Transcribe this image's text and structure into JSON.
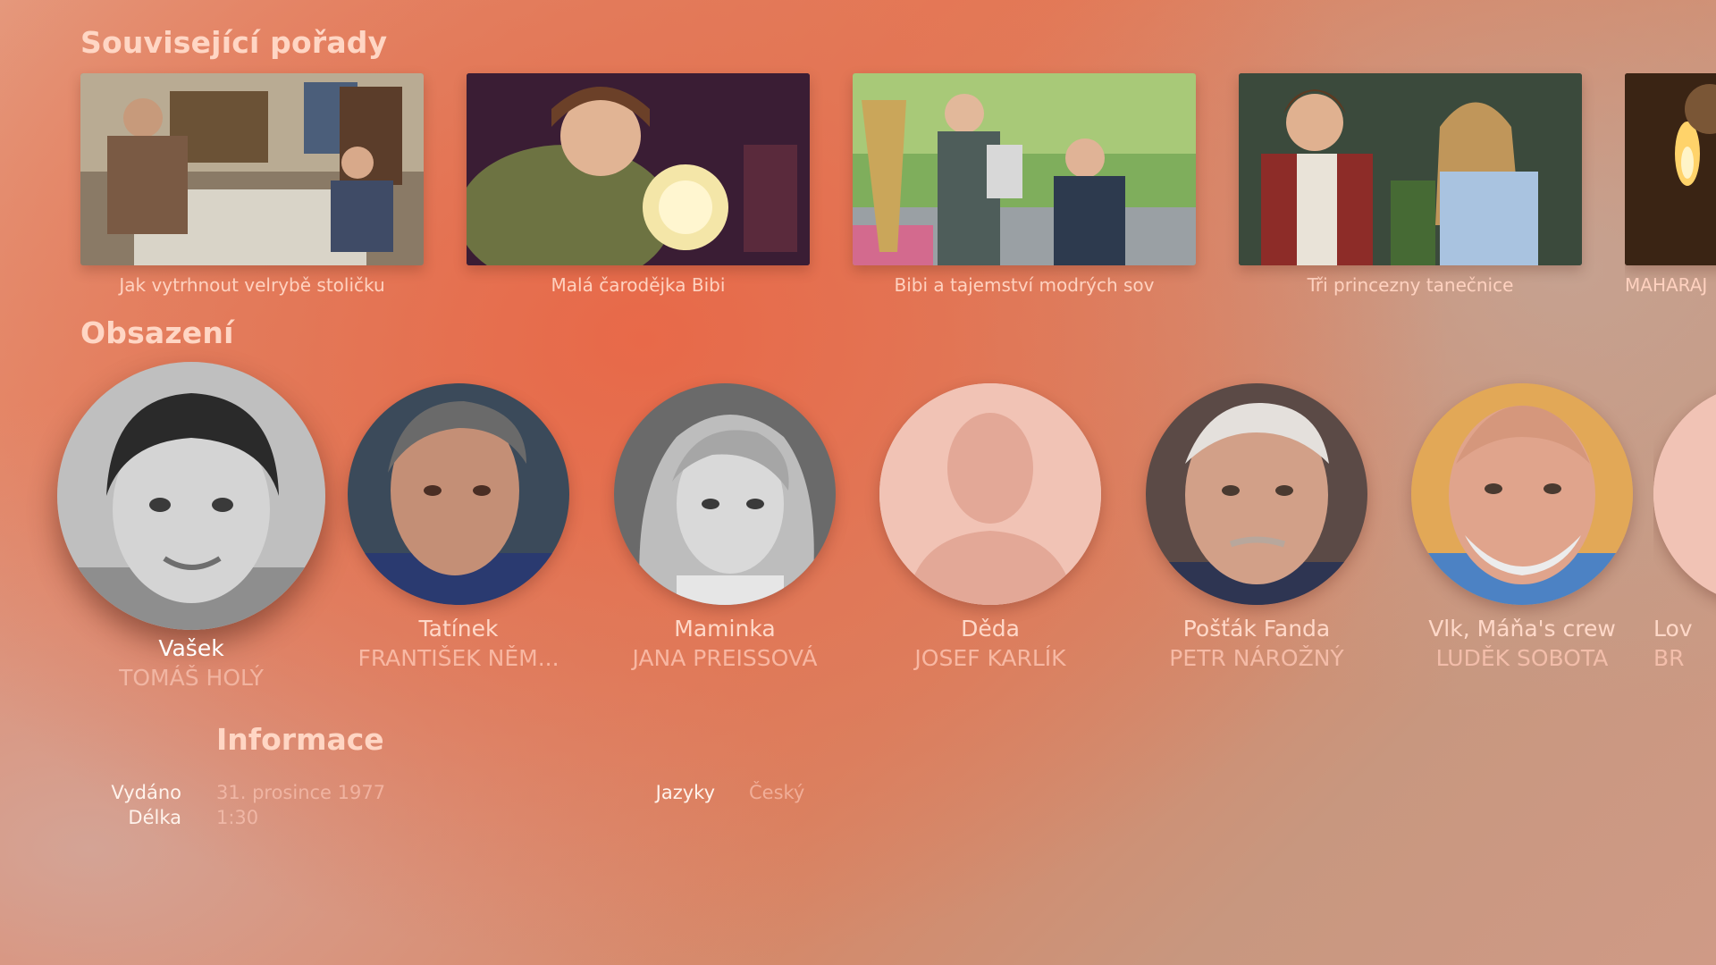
{
  "sections": {
    "related_title": "Související pořady",
    "cast_title": "Obsazení",
    "info_title": "Informace"
  },
  "related": [
    {
      "title": "Jak vytrhnout velrybě stoličku"
    },
    {
      "title": "Malá čarodějka Bibi"
    },
    {
      "title": "Bibi a tajemství modrých sov"
    },
    {
      "title": "Tři princezny tanečnice"
    },
    {
      "title": "MAHARAJ"
    }
  ],
  "cast": [
    {
      "role": "Vašek",
      "actor": "TOMÁŠ HOLÝ",
      "focused": true
    },
    {
      "role": "Tatínek",
      "actor": "FRANTIŠEK NĚM..."
    },
    {
      "role": "Maminka",
      "actor": "JANA PREISSOVÁ"
    },
    {
      "role": "Děda",
      "actor": "JOSEF KARLÍK"
    },
    {
      "role": "Pošťák Fanda",
      "actor": "PETR NÁROŽNÝ"
    },
    {
      "role": "Vlk, Máňa's crew",
      "actor": "LUDĚK SOBOTA"
    },
    {
      "role": "Lov",
      "actor": "BR"
    }
  ],
  "info": {
    "released_label": "Vydáno",
    "released_value": "31. prosince 1977",
    "length_label": "Délka",
    "length_value": "1:30",
    "languages_label": "Jazyky",
    "languages_value": "Český"
  },
  "colors": {
    "accent_text": "#ffd6c4",
    "background_core": "#e57a57",
    "placeholder_avatar": "#f1c3b5"
  }
}
